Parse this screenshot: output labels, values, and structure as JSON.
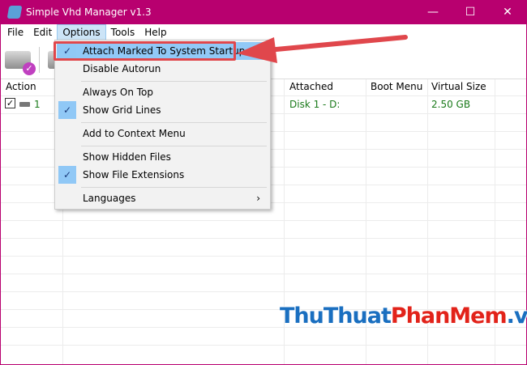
{
  "window": {
    "title": "Simple Vhd Manager v1.3",
    "minimize": "—",
    "maximize": "☐",
    "close": "✕"
  },
  "menubar": [
    "File",
    "Edit",
    "Options",
    "Tools",
    "Help"
  ],
  "table": {
    "headers": {
      "action": "Action",
      "attached": "Attached",
      "boot": "Boot Menu",
      "size": "Virtual Size"
    },
    "rows": [
      {
        "index": "1",
        "attached": "Disk 1  -  D:",
        "boot": "",
        "size": "2.50 GB",
        "checked": true
      }
    ]
  },
  "options_menu": {
    "items": [
      {
        "label": "Attach Marked To System Startup",
        "checked": true,
        "highlighted": true
      },
      {
        "label": "Disable Autorun",
        "checked": false
      },
      {
        "label": "Always On Top",
        "checked": false
      },
      {
        "label": "Show Grid Lines",
        "checked": true
      },
      {
        "label": "Add to Context Menu",
        "checked": false
      },
      {
        "label": "Show Hidden Files",
        "checked": false
      },
      {
        "label": "Show File Extensions",
        "checked": true
      },
      {
        "label": "Languages",
        "checked": false,
        "submenu": "›"
      }
    ]
  },
  "watermark": {
    "part1": "ThuThuat",
    "part2": "PhanMem",
    "part3": ".vn",
    "colors": {
      "part1": "#1a6fc0",
      "part2": "#e2231a",
      "part3": "#1a6fc0"
    }
  },
  "colors": {
    "titlebar": "#b8006f",
    "highlight": "#91c9f7",
    "annotation": "#e0474c"
  }
}
